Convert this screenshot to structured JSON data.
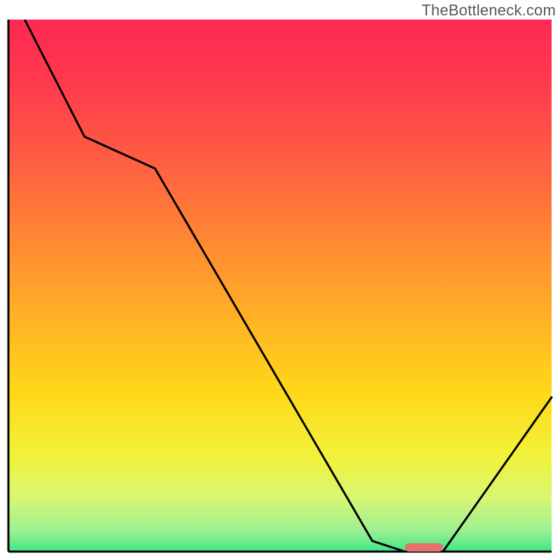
{
  "watermark": "TheBottleneck.com",
  "chart_data": {
    "type": "line",
    "title": "",
    "xlabel": "",
    "ylabel": "",
    "xlim": [
      0,
      100
    ],
    "ylim": [
      0,
      100
    ],
    "grid": false,
    "legend": false,
    "series": [
      {
        "name": "bottleneck-curve",
        "x": [
          3,
          14,
          27,
          67,
          73,
          80,
          100
        ],
        "values": [
          100,
          78,
          72,
          2,
          0,
          0,
          29
        ]
      }
    ],
    "marker": {
      "name": "optimal-segment",
      "x_start": 73,
      "x_end": 80,
      "y": 0,
      "color": "#e8706f"
    },
    "background_gradient": {
      "stops": [
        {
          "offset": 0.0,
          "color": "#fe2854"
        },
        {
          "offset": 0.12,
          "color": "#ff3a4e"
        },
        {
          "offset": 0.25,
          "color": "#ff5a43"
        },
        {
          "offset": 0.4,
          "color": "#ff8434"
        },
        {
          "offset": 0.55,
          "color": "#ffae26"
        },
        {
          "offset": 0.7,
          "color": "#ffd818"
        },
        {
          "offset": 0.82,
          "color": "#f2f23a"
        },
        {
          "offset": 0.9,
          "color": "#d8f673"
        },
        {
          "offset": 0.96,
          "color": "#9df093"
        },
        {
          "offset": 1.0,
          "color": "#3de787"
        }
      ]
    },
    "axis_color": "#000000",
    "line_color": "#000000"
  }
}
